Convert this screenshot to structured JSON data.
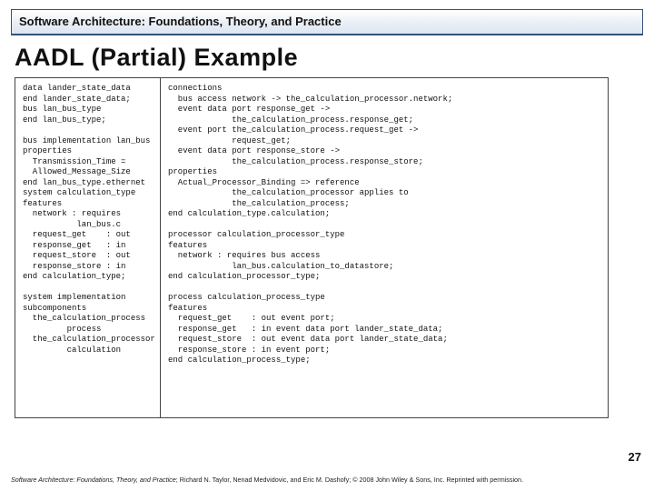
{
  "header": {
    "title": "Software Architecture: Foundations, Theory, and Practice"
  },
  "slide": {
    "title": "AADL (Partial) Example",
    "page_number": "27"
  },
  "code": {
    "left": "data lander_state_data\nend lander_state_data;\nbus lan_bus_type\nend lan_bus_type;\n\nbus implementation lan_bus\nproperties\n  Transmission_Time =\n  Allowed_Message_Size\nend lan_bus_type.ethernet\nsystem calculation_type\nfeatures\n  network : requires\n           lan_bus.c\n  request_get    : out\n  response_get   : in\n  request_store  : out\n  response_store : in\nend calculation_type;\n\nsystem implementation\nsubcomponents\n  the_calculation_process\n         process\n  the_calculation_processor\n         calculation",
    "right": "connections\n  bus access network -> the_calculation_processor.network;\n  event data port response_get ->\n             the_calculation_process.response_get;\n  event port the_calculation_process.request_get ->\n             request_get;\n  event data port response_store ->\n             the_calculation_process.response_store;\nproperties\n  Actual_Processor_Binding => reference\n             the_calculation_processor applies to\n             the_calculation_process;\nend calculation_type.calculation;\n\nprocessor calculation_processor_type\nfeatures\n  network : requires bus access\n             lan_bus.calculation_to_datastore;\nend calculation_processor_type;\n\nprocess calculation_process_type\nfeatures\n  request_get    : out event port;\n  response_get   : in event data port lander_state_data;\n  request_store  : out event data port lander_state_data;\n  response_store : in event port;\nend calculation_process_type;"
  },
  "footer": {
    "book_title": "Software Architecture: Foundations, Theory, and Practice",
    "rest": "; Richard N. Taylor, Nenad Medvidovic, and Eric M. Dashofy; © 2008 John Wiley & Sons, Inc. Reprinted with permission."
  }
}
